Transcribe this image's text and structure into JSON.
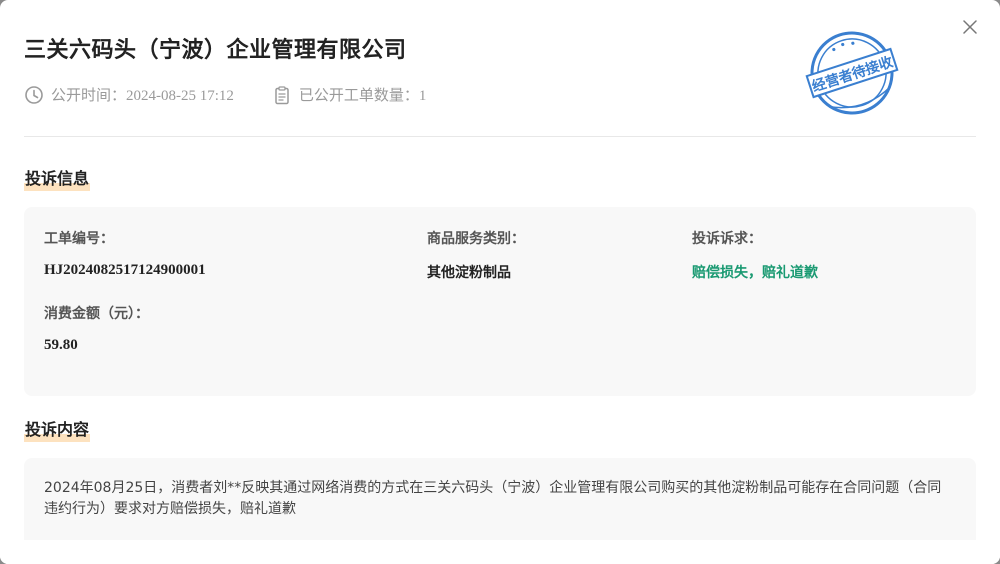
{
  "modal": {
    "title": "三关六码头（宁波）企业管理有限公司",
    "close_icon": "close-icon"
  },
  "meta": {
    "public_time": "公开时间：2024-08-25 17:12",
    "public_count": "已公开工单数量：1",
    "time_icon": "clock-icon",
    "count_icon": "clipboard-icon"
  },
  "stamp": {
    "text": "经营者待接收",
    "color": "#3a7fd0"
  },
  "complaint_info": {
    "section_title": "投诉信息",
    "ticket_label": "工单编号：",
    "ticket_value": "HJ2024082517124900001",
    "category_label": "商品服务类别：",
    "category_value": "其他淀粉制品",
    "demand_label": "投诉诉求：",
    "demand_value": "赔偿损失，赔礼道歉",
    "demand_color": "#1a9a72",
    "amount_label": "消费金额（元）：",
    "amount_value": "59.80"
  },
  "complaint_content": {
    "section_title": "投诉内容",
    "text": "2024年08月25日，消费者刘**反映其通过网络消费的方式在三关六码头（宁波）企业管理有限公司购买的其他淀粉制品可能存在合同问题（合同违约行为）要求对方赔偿损失，赔礼道歉"
  },
  "colors": {
    "accent_underline": "#fde2bf",
    "panel_bg": "#f8f8f8"
  }
}
